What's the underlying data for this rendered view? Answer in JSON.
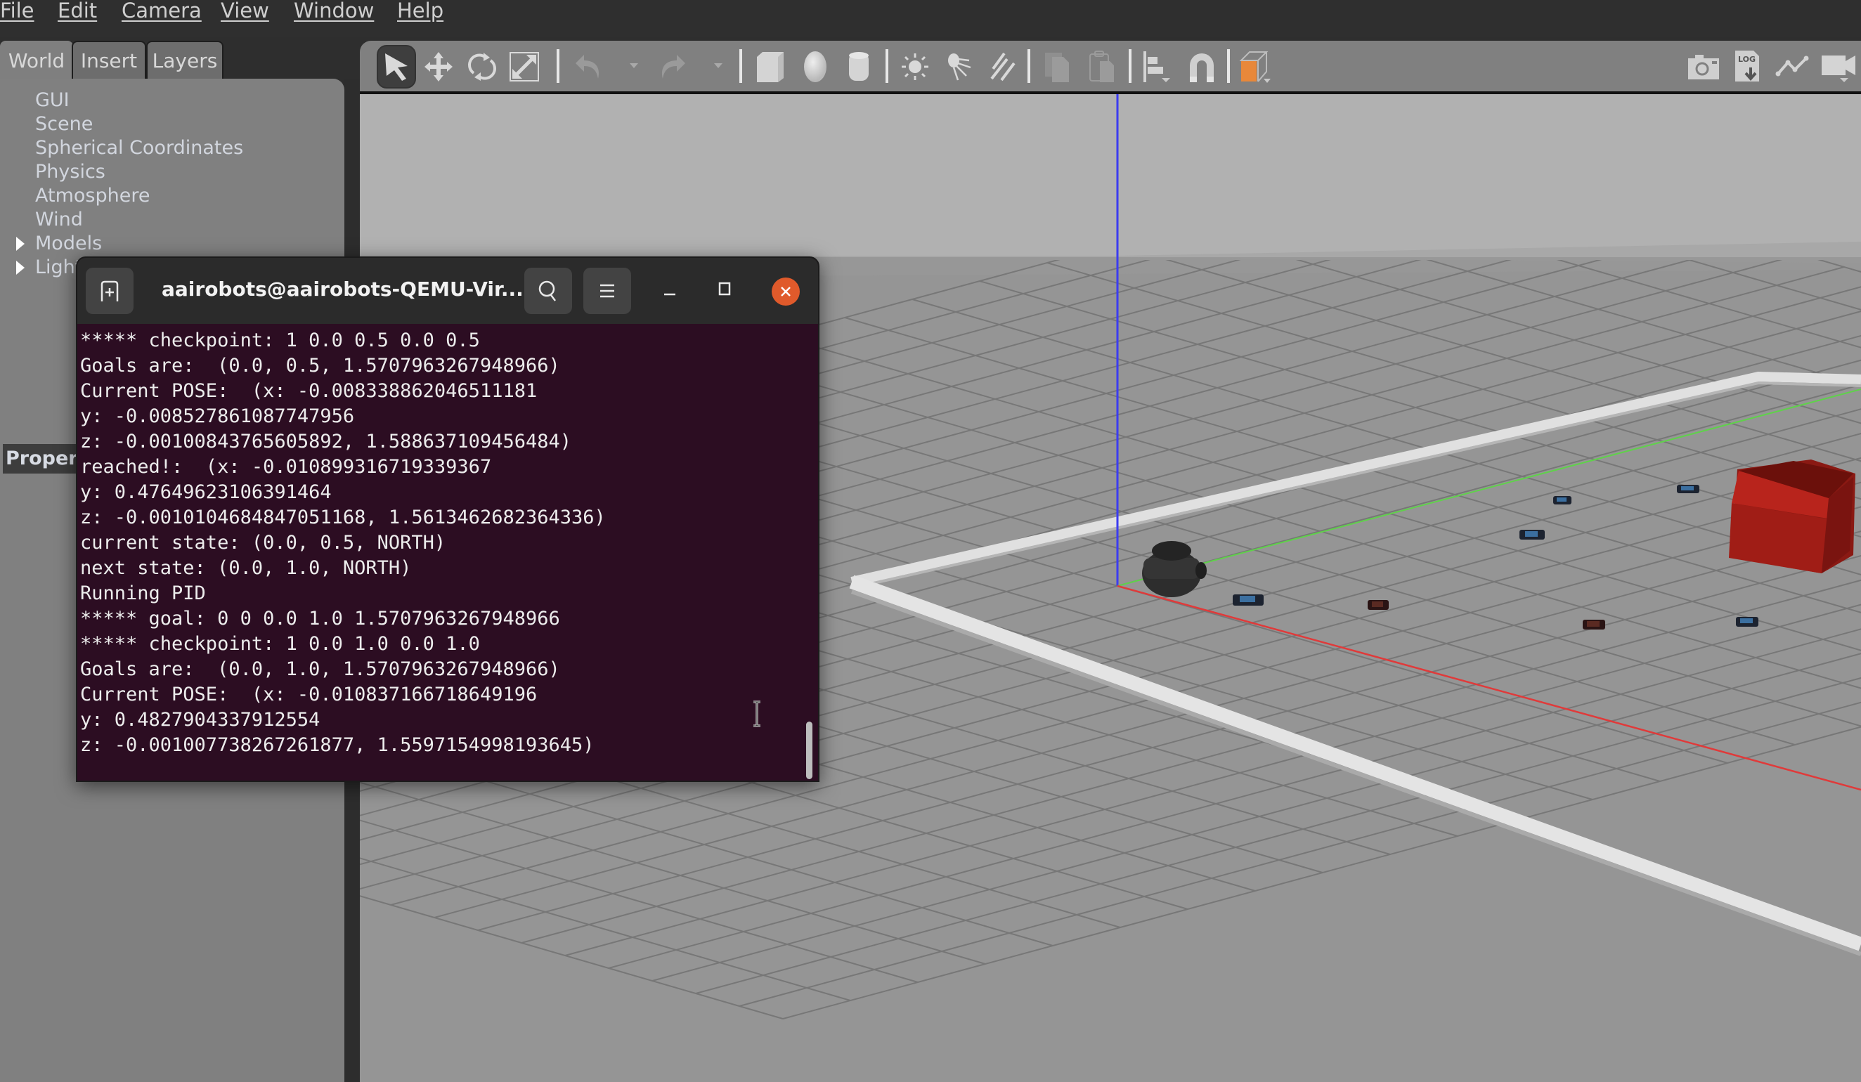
{
  "menubar": {
    "items": [
      {
        "label": "File",
        "mnemonic": "F"
      },
      {
        "label": "Edit",
        "mnemonic": "E"
      },
      {
        "label": "Camera",
        "mnemonic": "C"
      },
      {
        "label": "View",
        "mnemonic": "V"
      },
      {
        "label": "Window",
        "mnemonic": "W"
      },
      {
        "label": "Help",
        "mnemonic": "H"
      }
    ]
  },
  "left_panel": {
    "tabs": [
      {
        "label": "World",
        "active": true
      },
      {
        "label": "Insert",
        "active": false
      },
      {
        "label": "Layers",
        "active": false
      }
    ],
    "tree": [
      {
        "label": "GUI",
        "expandable": false
      },
      {
        "label": "Scene",
        "expandable": false
      },
      {
        "label": "Spherical Coordinates",
        "expandable": false
      },
      {
        "label": "Physics",
        "expandable": false
      },
      {
        "label": "Atmosphere",
        "expandable": false
      },
      {
        "label": "Wind",
        "expandable": false
      },
      {
        "label": "Models",
        "expandable": true
      },
      {
        "label": "Lights",
        "expandable": true
      }
    ],
    "properties_label": "Properties"
  },
  "toolbar": {
    "tools": [
      {
        "name": "select-mode",
        "active": true
      },
      {
        "name": "translate-mode"
      },
      {
        "name": "rotate-mode"
      },
      {
        "name": "scale-mode"
      },
      {
        "name": "undo",
        "disabled": true
      },
      {
        "name": "redo",
        "disabled": true
      },
      {
        "name": "box-shape"
      },
      {
        "name": "sphere-shape"
      },
      {
        "name": "cylinder-shape"
      },
      {
        "name": "point-light"
      },
      {
        "name": "spot-light"
      },
      {
        "name": "directional-light"
      },
      {
        "name": "copy",
        "disabled": true
      },
      {
        "name": "paste",
        "disabled": true
      },
      {
        "name": "align"
      },
      {
        "name": "snap"
      },
      {
        "name": "view-angle"
      }
    ],
    "right_tools": [
      {
        "name": "screenshot"
      },
      {
        "name": "log"
      },
      {
        "name": "plot"
      },
      {
        "name": "video-record"
      }
    ],
    "accent_color": "#e8883a"
  },
  "terminal": {
    "title": "aairobots@aairobots-QEMU-Vir...",
    "close_color": "#e05a2b",
    "background": "#2c0d22",
    "lines": [
      "***** checkpoint: 1 0.0 0.5 0.0 0.5",
      "Goals are:  (0.0, 0.5, 1.5707963267948966)",
      "Current POSE:  (x: -0.008338862046511181",
      "y: -0.008527861087747956",
      "z: -0.001008437656058​92, 1.588637109456484)",
      "reached!:  (x: -0.010899316719339367",
      "y: 0.47649623106391464",
      "z: -0.0010104684847051168, 1.5613462682364336)",
      "current state: (0.0, 0.5, NORTH)",
      "next state: (0.0, 1.0, NORTH)",
      "Running PID",
      "***** goal: 0 0 0.0 1.0 1.5707963267948966",
      "***** checkpoint: 1 0.0 1.0 0.0 1.0",
      "Goals are:  (0.0, 1.0, 1.5707963267948966)",
      "Current POSE:  (x: -0.010837166718649196",
      "y: 0.4827904337912554",
      "z: -0.001007738267261877, 1.5597154998193645)"
    ]
  },
  "scene": {
    "axis_colors": {
      "x": "#e03a3a",
      "y": "#5fd24a",
      "z": "#3c3cf0"
    },
    "box_color": "#b5221c",
    "objects": [
      "robot",
      "red-box",
      "blue-tag",
      "brown-tag",
      "wall-boundary"
    ]
  }
}
